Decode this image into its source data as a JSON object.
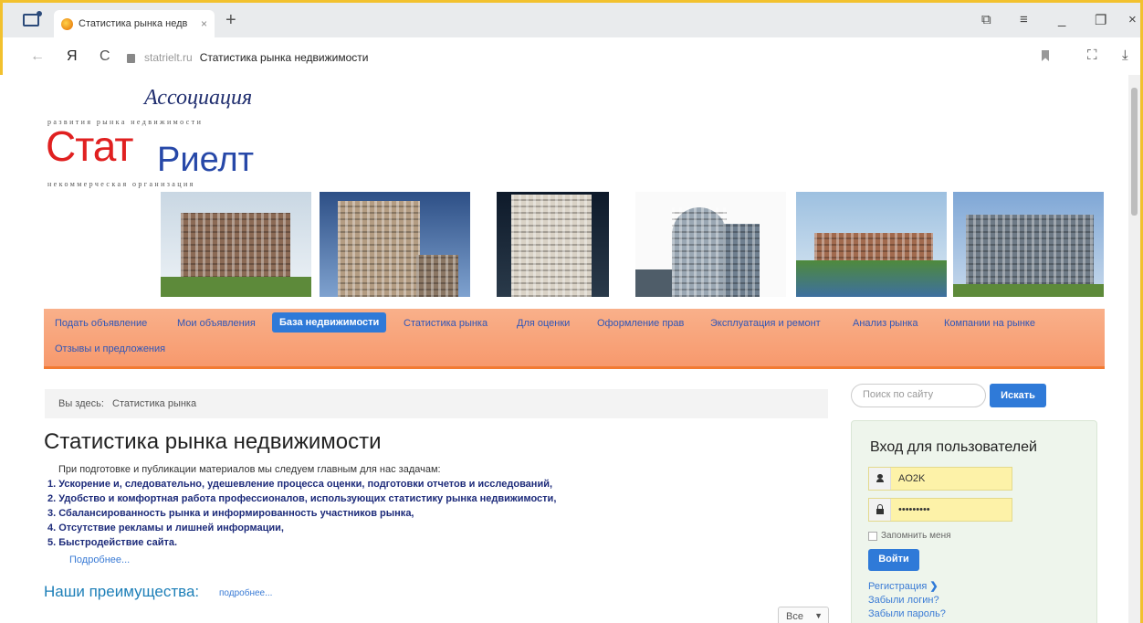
{
  "browser": {
    "tab_title": "Статистика рынка недв",
    "tab_close": "×",
    "newtab": "+",
    "back": "←",
    "yandex": "Я",
    "reload": "C",
    "url_domain": "statrielt.ru",
    "url_title": "Статистика рынка недвижимости",
    "download": "⤓",
    "minimize": "_",
    "restore": "❐",
    "close": "×",
    "menu": "≡"
  },
  "logo": {
    "assoc": "Ассоциация",
    "sub1": "развития рынка недвижимости",
    "stat": "Стат",
    "rielt": "Риелт",
    "sub2": "некоммерческая организация"
  },
  "menu": {
    "items": [
      "Подать объявление",
      "Мои объявления",
      "База недвижимости",
      "Статистика рынка",
      "Для оценки",
      "Оформление прав",
      "Эксплуатация и ремонт",
      "Анализ рынка",
      "Компании на рынке",
      "Отзывы и предложения"
    ],
    "active_index": 2
  },
  "breadcrumb": {
    "label": "Вы здесь:",
    "current": "Статистика рынка"
  },
  "content": {
    "title": "Статистика рынка недвижимости",
    "intro": "При подготовке и публикации материалов мы следуем главным для нас задачам:",
    "goals": [
      "1. Ускорение и, следовательно, удешевление процесса оценки, подготовки отчетов и исследований,",
      "2. Удобство и комфортная работа профессионалов, использующих статистику рынка недвижимости,",
      "3. Сбалансированность рынка и информированность участников рынка,",
      "4. Отсутствие рекламы и лишней информации,",
      "5. Быстродействие сайта."
    ],
    "more": "Подробнее...",
    "advantages_title": "Наши преимущества:",
    "advantages_more": "подробнее...",
    "select_value": "Все"
  },
  "search": {
    "placeholder": "Поиск по сайту",
    "button": "Искать"
  },
  "login": {
    "title": "Вход для пользователей",
    "username": "AO2K",
    "password": "•••••••••",
    "remember": "Запомнить меня",
    "button": "Войти",
    "register": "Регистрация",
    "forgot_login": "Забыли логин?",
    "forgot_password": "Забыли пароль?"
  },
  "colors": {
    "menu_bg": "#f7996d",
    "accent": "#2f7ad8",
    "logo_red": "#e02020",
    "logo_blue": "#2748a8"
  }
}
